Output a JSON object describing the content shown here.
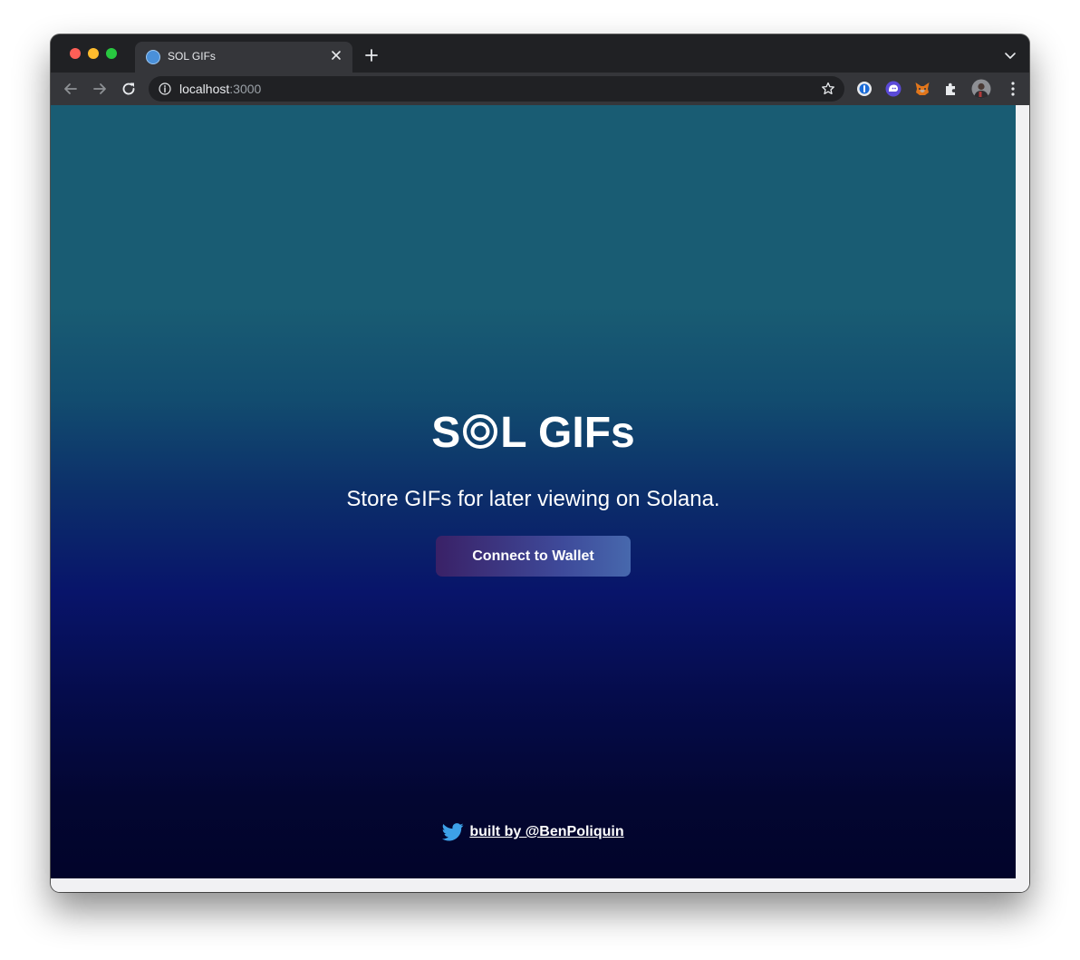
{
  "browser": {
    "tab": {
      "title": "SOL GIFs"
    },
    "address_bar": {
      "host": "localhost",
      "port": ":3000"
    },
    "icons": {
      "back": "arrow-left-icon",
      "forward": "arrow-right-icon",
      "reload": "reload-icon",
      "info": "info-icon",
      "bookmark": "star-icon",
      "extensions": [
        "one-password-icon",
        "phantom-ghost-icon",
        "metamask-fox-icon",
        "puzzle-piece-icon",
        "profile-avatar"
      ],
      "menu": "three-dots-icon"
    },
    "colors": {
      "frame": "#202124",
      "toolbar": "#35363a"
    }
  },
  "page": {
    "title_part1": "S",
    "title_part2": "L GIFs",
    "subtitle": "Store GIFs for later viewing on Solana.",
    "connect_button": "Connect to Wallet",
    "footer_link": "built by @BenPoliquin",
    "colors": {
      "gradient_top": "#195c73",
      "gradient_mid": "#08146a",
      "gradient_bottom": "#02042a",
      "button_start": "#3a2167",
      "button_end": "#4768ad",
      "twitter": "#3da1e8"
    }
  }
}
